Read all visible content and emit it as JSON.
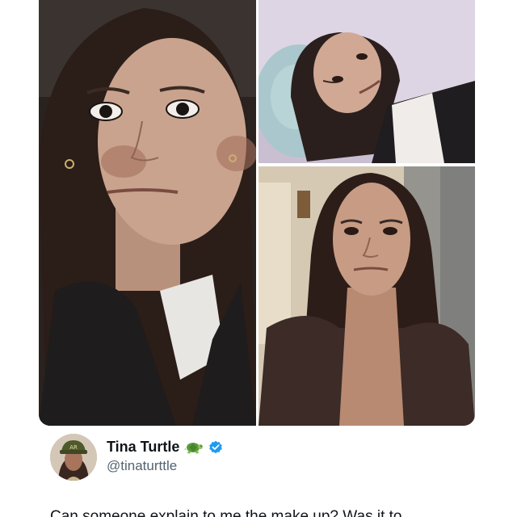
{
  "tweet": {
    "author": {
      "display_name": "Tina Turtle",
      "handle": "@tinaturttle",
      "name_emoji_icon": "turtle-icon",
      "verified_icon": "verified-badge-icon"
    },
    "text": "Can someone explain to me the make up? Was it to",
    "media": {
      "count": 3,
      "layout": "one-large-left-two-stacked-right"
    }
  },
  "colors": {
    "text_primary": "#0f1419",
    "text_secondary": "#536471",
    "verified_blue": "#1d9bf0",
    "background": "#ffffff"
  }
}
